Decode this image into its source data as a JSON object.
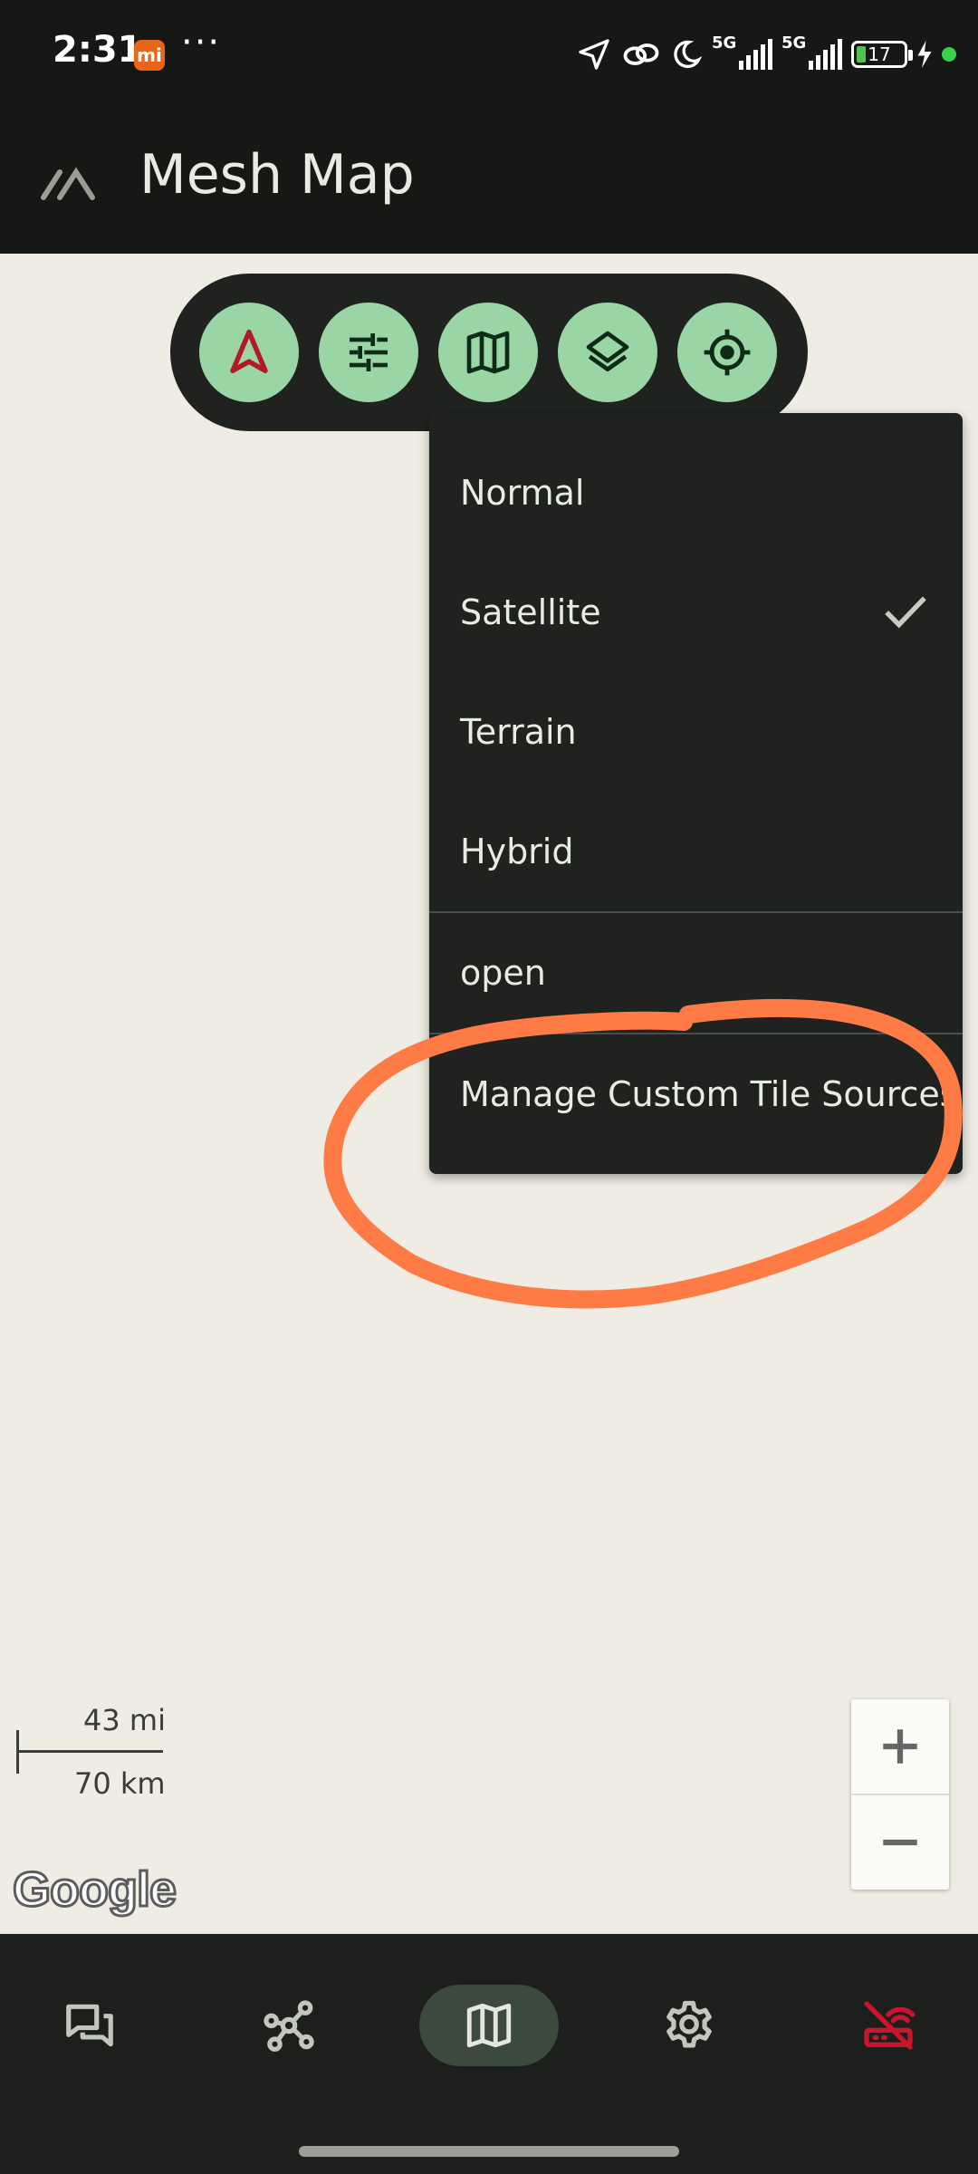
{
  "status_bar": {
    "time": "2:31",
    "mi_badge": "mi",
    "overflow": "···",
    "signal_1": "5G",
    "signal_2": "5G",
    "battery": "17",
    "icons": [
      "location-arrow-icon",
      "link-icon",
      "moon-icon",
      "signal-icon",
      "battery-icon",
      "charging-icon"
    ]
  },
  "app_bar": {
    "title": "Mesh Map",
    "logo_icon": "mesh-logo-icon"
  },
  "toolbar": {
    "buttons": [
      {
        "name": "navigation-button",
        "icon": "navigation-arrow-icon"
      },
      {
        "name": "filter-button",
        "icon": "tune-sliders-icon"
      },
      {
        "name": "map-type-button",
        "icon": "map-icon"
      },
      {
        "name": "layers-button",
        "icon": "layers-icon"
      },
      {
        "name": "my-location-button",
        "icon": "crosshair-icon"
      }
    ]
  },
  "map_type_menu": {
    "items": [
      {
        "label": "Normal",
        "selected": false
      },
      {
        "label": "Satellite",
        "selected": true
      },
      {
        "label": "Terrain",
        "selected": false
      },
      {
        "label": "Hybrid",
        "selected": false
      }
    ],
    "custom_source": "open",
    "manage_label": "Manage Custom Tile Sources"
  },
  "map": {
    "scale_mi": "43 mi",
    "scale_km": "70 km",
    "attribution": "Google",
    "zoom_in": "+",
    "zoom_out": "−"
  },
  "bottom_nav": {
    "items": [
      {
        "name": "messages",
        "icon": "chat-icon",
        "active": false
      },
      {
        "name": "nodes",
        "icon": "network-nodes-icon",
        "active": false
      },
      {
        "name": "map",
        "icon": "map-icon",
        "active": true
      },
      {
        "name": "settings",
        "icon": "gear-icon",
        "active": false
      },
      {
        "name": "connection",
        "icon": "router-disconnected-icon",
        "active": false
      }
    ]
  },
  "colors": {
    "accent_green": "#9ad5a6",
    "bar_dark": "#151815",
    "map_bg": "#efece3",
    "annotation_orange": "#ff7b45",
    "disconnected_red": "#c8162e"
  }
}
